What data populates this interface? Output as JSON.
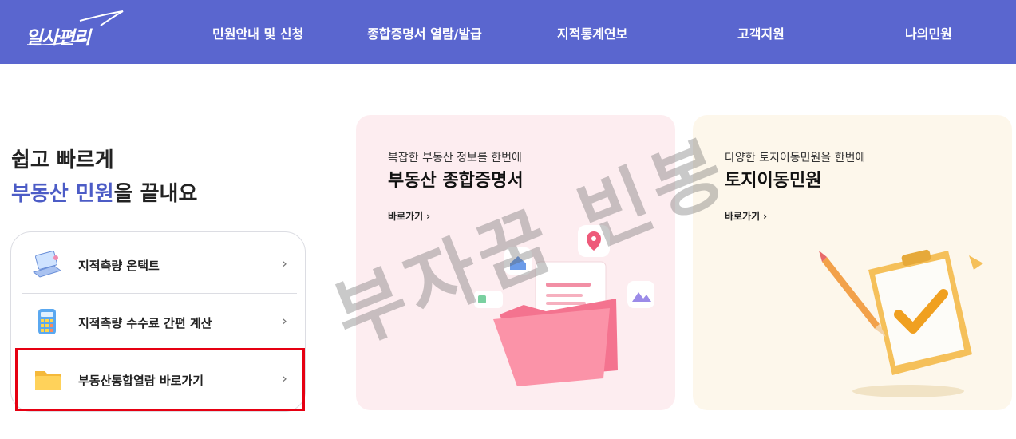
{
  "header": {
    "logo_text": "일사편리",
    "nav": [
      {
        "label": "민원안내 및 신청"
      },
      {
        "label": "종합증명서 열람/발급"
      },
      {
        "label": "지적통계연보"
      },
      {
        "label": "고객지원"
      },
      {
        "label": "나의민원"
      }
    ]
  },
  "hero": {
    "line1": "쉽고 빠르게",
    "line2_accent": "부동산 민원",
    "line2_rest": "을 끝내요"
  },
  "quick_menu": [
    {
      "label": "지적측량 온택트",
      "icon": "laptop-icon"
    },
    {
      "label": "지적측량 수수료 간편 계산",
      "icon": "calculator-icon"
    },
    {
      "label": "부동산통합열람 바로가기",
      "icon": "folder-icon"
    }
  ],
  "chevron": "›",
  "promos": [
    {
      "subtitle": "복잡한 부동산 정보를 한번에",
      "title": "부동산 종합증명서",
      "link": "바로가기",
      "arrow": "›",
      "illustration": "pink-folder-with-documents"
    },
    {
      "subtitle": "다양한 토지이동민원을 한번에",
      "title": "토지이동민원",
      "link": "바로가기",
      "arrow": "›",
      "illustration": "clipboard-with-pencil-checkmark"
    }
  ],
  "watermark": "부자꿈 빈봉",
  "colors": {
    "header": "#5a66cf",
    "accent": "#4c5cc6",
    "highlight_box": "#e60012"
  }
}
